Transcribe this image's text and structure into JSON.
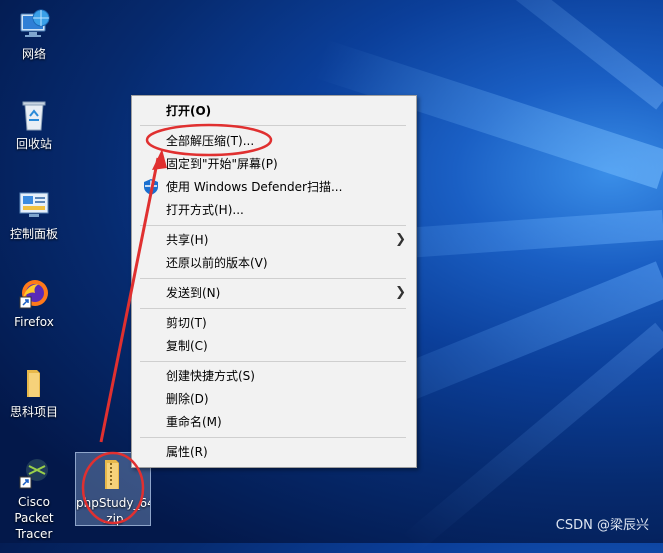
{
  "desktop_icons": [
    {
      "label": "网络",
      "icon": "network-icon"
    },
    {
      "label": "回收站",
      "icon": "recycle-bin-icon"
    },
    {
      "label": "控制面板",
      "icon": "control-panel-icon"
    },
    {
      "label": "Firefox",
      "icon": "firefox-icon"
    },
    {
      "label": "思科项目",
      "icon": "folder-icon"
    },
    {
      "label_line1": "Cisco Packet",
      "label_line2": "Tracer",
      "icon": "cisco-packet-tracer-icon"
    },
    {
      "label_line1": "phpStudy_64",
      "label_line2": ".zip",
      "icon": "zip-archive-icon"
    }
  ],
  "context_menu": {
    "items": [
      {
        "label": "打开(O)"
      },
      {
        "label": "全部解压缩(T)..."
      },
      {
        "label": "固定到\"开始\"屏幕(P)"
      },
      {
        "label": "使用 Windows Defender扫描..."
      },
      {
        "label": "打开方式(H)..."
      },
      {
        "label": "共享(H)"
      },
      {
        "label": "还原以前的版本(V)"
      },
      {
        "label": "发送到(N)"
      },
      {
        "label": "剪切(T)"
      },
      {
        "label": "复制(C)"
      },
      {
        "label": "创建快捷方式(S)"
      },
      {
        "label": "删除(D)"
      },
      {
        "label": "重命名(M)"
      },
      {
        "label": "属性(R)"
      }
    ]
  },
  "annotation_color": "#e03030",
  "watermark": "CSDN @梁辰兴"
}
